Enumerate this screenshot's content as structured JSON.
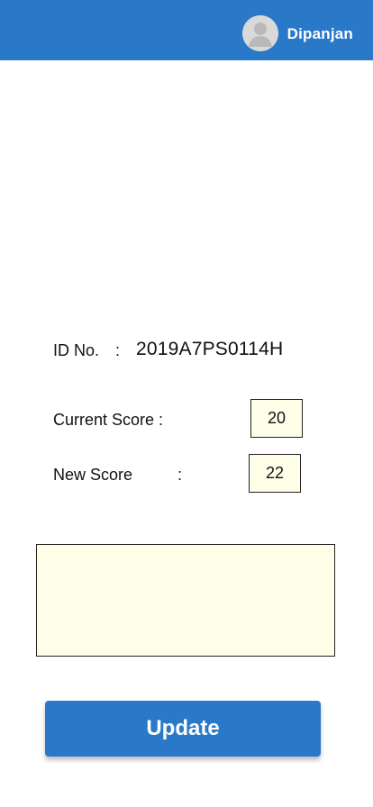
{
  "header": {
    "username": "Dipanjan",
    "avatar_icon": "user-avatar-icon",
    "background_color": "#2a79c9"
  },
  "student": {
    "id_label": "ID No.",
    "id_separator": ":",
    "id_value": "2019A7PS0114H"
  },
  "scores": {
    "current_label": "Current Score :",
    "current_value": "20",
    "new_label": "New Score",
    "new_separator": ":",
    "new_value": "22"
  },
  "comment": {
    "value": "",
    "background_color": "#fefee9"
  },
  "actions": {
    "update_label": "Update",
    "button_color": "#2a79c9"
  }
}
